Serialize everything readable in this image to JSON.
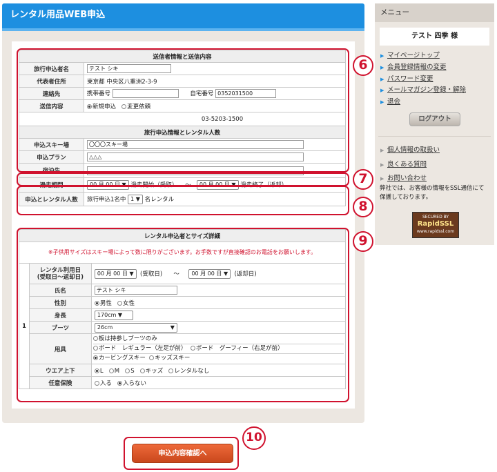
{
  "main_title": "レンタル用品WEB申込",
  "section1": {
    "title": "送信者情報と送信内容",
    "applicant_label": "旅行申込者名",
    "applicant_value": "テスト シキ",
    "address_label": "代表者住所",
    "address_value": "東京都 中央区八重洲2-3-9",
    "contact_label": "連絡先",
    "mobile_label": "携帯番号",
    "mobile_value": "",
    "home_label": "自宅番号",
    "home_value": "0352031500",
    "send_label": "送信内容",
    "send_options": [
      "新規申込",
      "変更依頼"
    ],
    "phone_line": "03-5203-1500"
  },
  "section2": {
    "title": "旅行申込情報とレンタル人数",
    "ski_label": "申込スキー場",
    "ski_value": "〇〇〇スキー場",
    "plan_label": "申込プラン",
    "plan_value": "△△△",
    "stay_label": "宿泊先",
    "stay_value": "",
    "period_label": "滑走期間",
    "start_select": "00 月 00 日",
    "start_text": "滑走開始（受取）",
    "tilde": "～",
    "end_select": "00 月 00 日",
    "end_text": "滑走終了（返却）",
    "people_label": "申込とレンタル人数",
    "people_prefix": "旅行申込1名中",
    "people_select": "1",
    "people_suffix": "名レンタル"
  },
  "section3": {
    "title": "レンタル申込者とサイズ詳細",
    "notice": "※子供用サイズはスキー場によって数に限りがございます。お手数ですが直接確認のお電話をお願いします。",
    "row_number": "1",
    "date_label_1": "レンタル利用日",
    "date_label_2": "(受取日～返却日)",
    "receive_select": "00 月 00 日",
    "receive_text": "(受取日)",
    "tilde": "～",
    "return_select": "00 月 00 日",
    "return_text": "(返却日)",
    "name_label": "氏名",
    "name_value": "テスト シキ",
    "gender_label": "性別",
    "gender_options": [
      "男性",
      "女性"
    ],
    "height_label": "身長",
    "height_value": "170cm",
    "boots_label": "ブーツ",
    "boots_value": "26cm",
    "equip_label": "用具",
    "equip_options": [
      "板は持参しブーツのみ",
      "ボード　レギュラー（左足が前）",
      "ボード　グーフィー（右足が前）",
      "カービングスキー",
      "キッズスキー"
    ],
    "wear_label": "ウエア上下",
    "wear_options": [
      "L",
      "M",
      "S",
      "キッズ",
      "レンタルなし"
    ],
    "insurance_label": "任意保険",
    "insurance_options": [
      "入る",
      "入らない"
    ]
  },
  "markers": {
    "m6": "6",
    "m7": "7",
    "m8": "8",
    "m9": "9",
    "m10": "10"
  },
  "submit_label": "申込内容確認へ",
  "sidebar": {
    "title": "メニュー",
    "user": "テスト 四季 様",
    "links": [
      "マイページトップ",
      "会員登録情報の変更",
      "パスワード変更",
      "メールマガジン登録・解除",
      "退会"
    ],
    "logout": "ログアウト",
    "links2": [
      "個人情報の取扱い",
      "良くある質問",
      "お問い合わせ"
    ],
    "ssl_text": "弊社では、お客様の情報をSSL通信にて保護しております。",
    "seal_top": "SECURED BY",
    "seal_brand": "RapidSSL",
    "seal_url": "www.rapidssl.com"
  },
  "colors": {
    "header_blue": "#1d8fe0",
    "marker_red": "#d0122e",
    "button_orange": "#e2592a",
    "panel_beige": "#ece7e1"
  }
}
